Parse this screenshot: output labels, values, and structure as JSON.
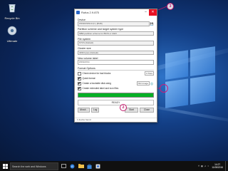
{
  "desktop": {
    "icons": [
      {
        "name": "recycle-bin-icon",
        "label": "Recycle Bin"
      },
      {
        "name": "usb-drive-icon",
        "label": "Ultimate"
      }
    ]
  },
  "rufus": {
    "title": "Rufus 2.9.875",
    "device_label": "Device",
    "device_value": "WINDOWS10 (F:) [8GB]",
    "partition_label": "Partition scheme and target system type",
    "partition_value": "MBR partition scheme for BIOS or UEFI",
    "filesystem_label": "File system",
    "filesystem_value": "NTFS (Default)",
    "cluster_label": "Cluster size",
    "cluster_value": "4096 bytes (Default)",
    "volume_label": "New volume label",
    "volume_value": "WIN10X64",
    "format_options_label": "Format Options",
    "check_bad_blocks": "Check device for bad blocks",
    "passes_value": "1 Pass",
    "quick_format": "Quick format",
    "create_bootable": "Create a bootable disk using",
    "iso_value": "ISO Image",
    "extended_label": "Create extended label and icon files",
    "status": "READY",
    "about_btn": "About...",
    "log_btn": "Log",
    "start_btn": "Start",
    "close_btn": "Close",
    "devices_found": "1 device found",
    "progress_percent": 100
  },
  "callouts": [
    "1",
    "2",
    "3"
  ],
  "taskbar": {
    "search_placeholder": "Search the web and Windows",
    "time": "14:27",
    "date": "11/08/2016"
  },
  "colors": {
    "close_red": "#e81123",
    "progress_green": "#06b025",
    "callout_magenta": "#c0186a",
    "taskbar": "#101010"
  }
}
